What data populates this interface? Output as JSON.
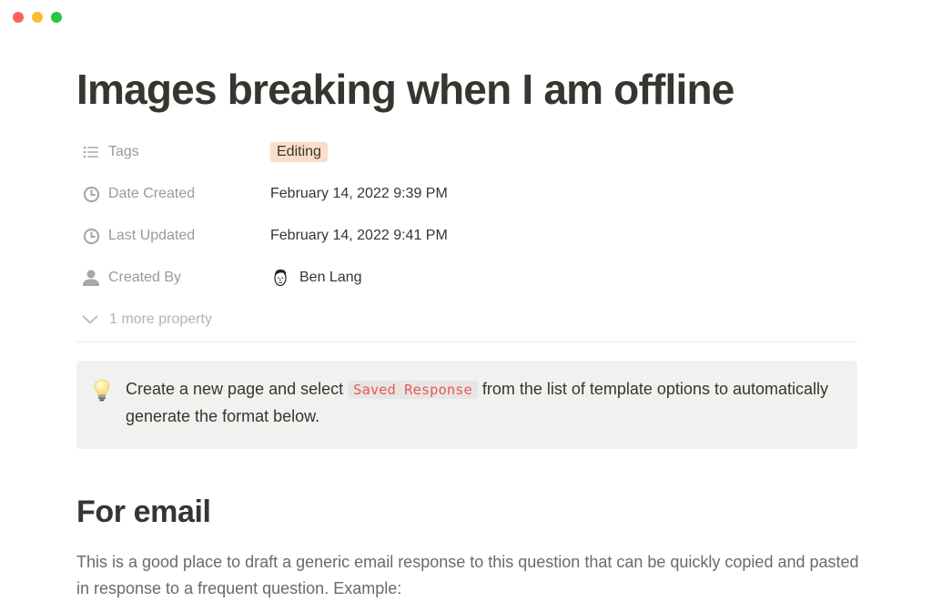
{
  "window": {
    "controls": [
      "close",
      "minimize",
      "maximize"
    ]
  },
  "page": {
    "title": "Images breaking when I am offline",
    "properties": [
      {
        "icon": "list-icon",
        "label": "Tags",
        "value": "Editing",
        "type": "tag",
        "tag_color": "#fadec9"
      },
      {
        "icon": "clock-icon",
        "label": "Date Created",
        "value": "February 14, 2022 9:39 PM",
        "type": "text"
      },
      {
        "icon": "clock-icon",
        "label": "Last Updated",
        "value": "February 14, 2022 9:41 PM",
        "type": "text"
      },
      {
        "icon": "person-icon",
        "label": "Created By",
        "value": "Ben Lang",
        "type": "person"
      }
    ],
    "more_properties": "1 more property",
    "callout": {
      "icon": "lightbulb-icon",
      "text_before": "Create a new page and select ",
      "code": "Saved Response",
      "text_after": " from the list of template options to automatically generate the format below."
    },
    "section_heading": "For email",
    "section_text": "This is a good place to draft a generic email response to this question that can be quickly copied and pasted in response to a frequent question. Example:"
  }
}
